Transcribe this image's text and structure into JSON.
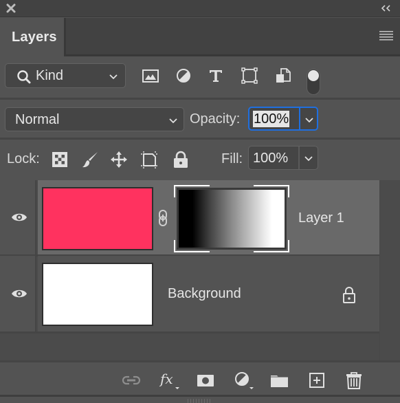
{
  "panel": {
    "title_tab": "Layers",
    "close_icon": "close-icon",
    "collapse_icon": "double-chevron-left-icon",
    "menu_icon": "hamburger-menu-icon"
  },
  "filter": {
    "kind_label": "Kind",
    "filter_icons": [
      "image-filter-icon",
      "adjustment-filter-icon",
      "type-filter-icon",
      "shape-filter-icon",
      "smart-object-filter-icon"
    ],
    "filter_toggle_on": true
  },
  "blend": {
    "mode": "Normal",
    "opacity_label": "Opacity:",
    "opacity_value": "100%"
  },
  "lock": {
    "label": "Lock:",
    "icons": [
      "lock-transparent-pixels-icon",
      "lock-image-pixels-icon",
      "lock-position-icon",
      "lock-artboard-icon",
      "lock-all-icon"
    ],
    "fill_label": "Fill:",
    "fill_value": "100%"
  },
  "layers": [
    {
      "name": "Layer 1",
      "visible": true,
      "selected": true,
      "thumbnail_color": "#ff325f",
      "has_mask": true,
      "mask": "black-to-white gradient",
      "linked_mask": true,
      "locked": false
    },
    {
      "name": "Background",
      "visible": true,
      "selected": false,
      "thumbnail_color": "#ffffff",
      "has_mask": false,
      "locked": true
    }
  ],
  "footer": {
    "icons": [
      "link-layers-icon",
      "fx-styles-icon",
      "add-mask-icon",
      "new-adjustment-layer-icon",
      "new-group-icon",
      "new-layer-icon",
      "delete-layer-icon"
    ]
  },
  "colors": {
    "accent_focus": "#1f6fe0",
    "selected_row": "#696969",
    "panel_bg": "#535353"
  }
}
